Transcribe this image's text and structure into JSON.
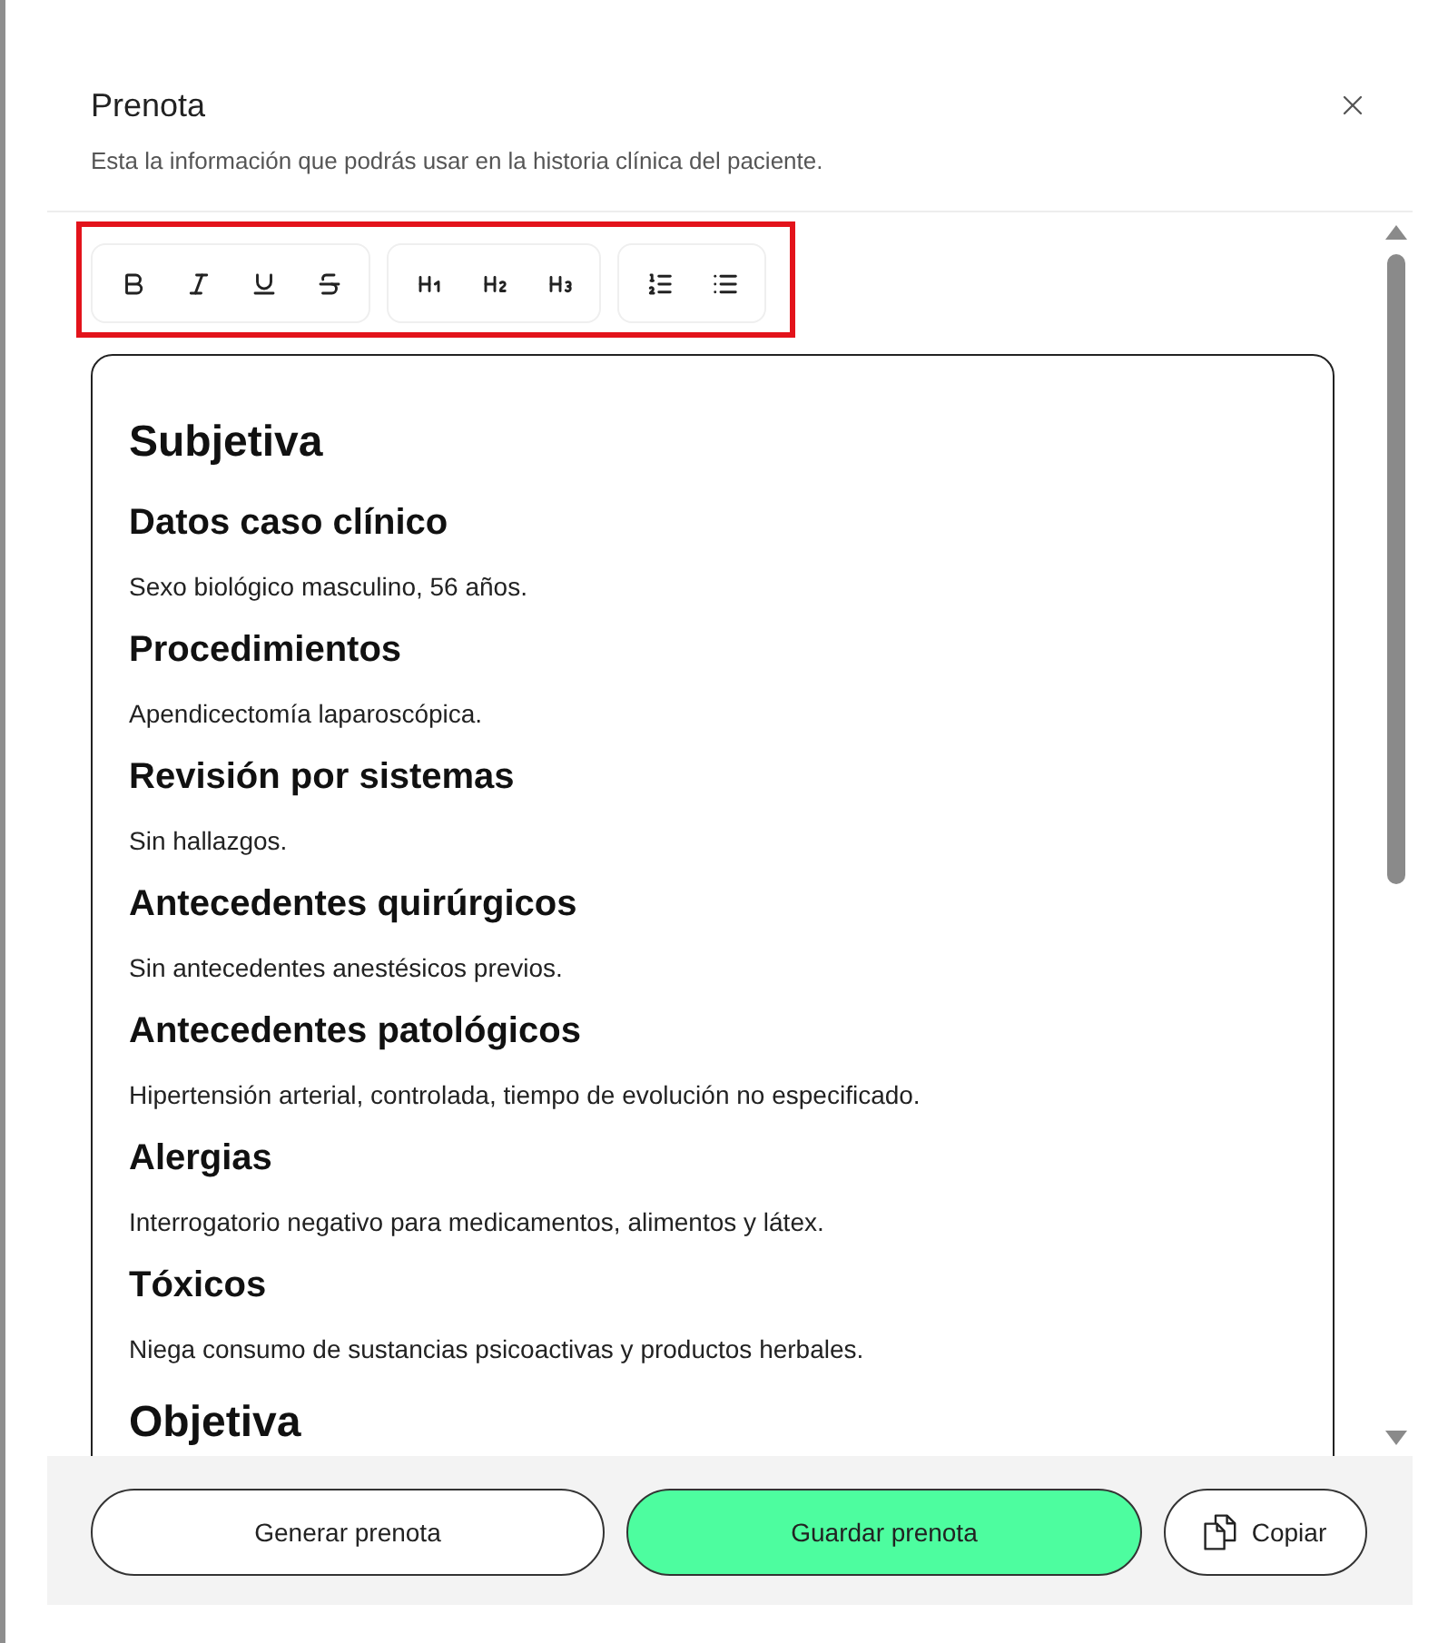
{
  "dialog": {
    "title": "Prenota",
    "subtitle": "Esta la información que podrás usar en la historia clínica del paciente."
  },
  "toolbar": {
    "highlighted": true,
    "groups": [
      {
        "buttons": [
          {
            "kind": "bold"
          },
          {
            "kind": "italic"
          },
          {
            "kind": "underline"
          },
          {
            "kind": "strike"
          }
        ]
      },
      {
        "buttons": [
          {
            "kind": "h1"
          },
          {
            "kind": "h2"
          },
          {
            "kind": "h3"
          }
        ]
      },
      {
        "buttons": [
          {
            "kind": "ordered_list"
          },
          {
            "kind": "bullet_list"
          }
        ]
      }
    ]
  },
  "editor": {
    "blocks": [
      {
        "kind": "h1",
        "text": "Subjetiva"
      },
      {
        "kind": "h2",
        "text": "Datos caso clínico"
      },
      {
        "kind": "p",
        "text": "Sexo biológico masculino, 56 años."
      },
      {
        "kind": "h2",
        "text": "Procedimientos"
      },
      {
        "kind": "p",
        "text": "Apendicectomía laparoscópica."
      },
      {
        "kind": "h2",
        "text": "Revisión por sistemas"
      },
      {
        "kind": "p",
        "text": "Sin hallazgos."
      },
      {
        "kind": "h2",
        "text": "Antecedentes quirúrgicos"
      },
      {
        "kind": "p",
        "text": "Sin antecedentes anestésicos previos."
      },
      {
        "kind": "h2",
        "text": "Antecedentes patológicos"
      },
      {
        "kind": "p",
        "text": "Hipertensión arterial, controlada, tiempo de evolución no especificado."
      },
      {
        "kind": "h2",
        "text": "Alergias"
      },
      {
        "kind": "p",
        "text": "Interrogatorio negativo para medicamentos, alimentos y látex."
      },
      {
        "kind": "h2",
        "text": "Tóxicos"
      },
      {
        "kind": "p",
        "text": "Niega consumo de sustancias psicoactivas y productos herbales."
      },
      {
        "kind": "h1",
        "text": "Objetiva"
      }
    ]
  },
  "actions": [
    {
      "kind": "secondary",
      "label": "Generar prenota"
    },
    {
      "kind": "primary",
      "label": "Guardar prenota"
    },
    {
      "kind": "copy",
      "label": "Copiar"
    }
  ]
}
